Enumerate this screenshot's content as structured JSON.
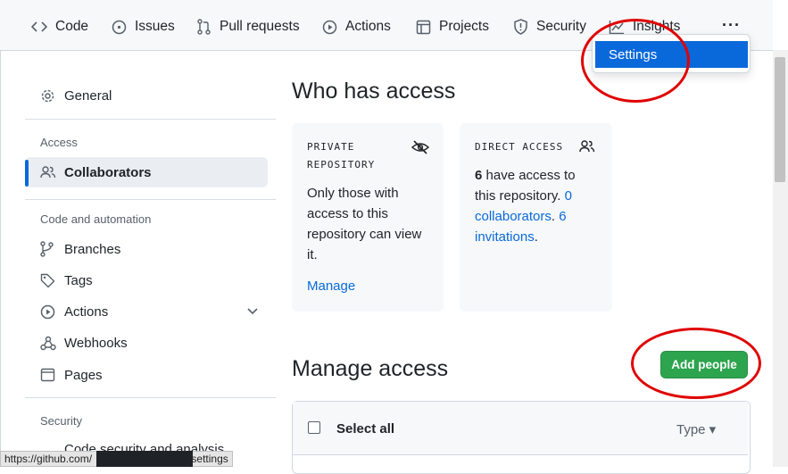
{
  "nav": {
    "items": [
      {
        "label": "Code",
        "icon": "code-icon"
      },
      {
        "label": "Issues",
        "icon": "issue-icon"
      },
      {
        "label": "Pull requests",
        "icon": "pull-request-icon"
      },
      {
        "label": "Actions",
        "icon": "play-icon"
      },
      {
        "label": "Projects",
        "icon": "table-icon"
      },
      {
        "label": "Security",
        "icon": "shield-icon"
      },
      {
        "label": "Insights",
        "icon": "graph-icon"
      }
    ],
    "more": "···"
  },
  "dropdown": {
    "settings_label": "Settings"
  },
  "sidebar": {
    "general": "General",
    "access_heading": "Access",
    "collaborators": "Collaborators",
    "code_heading": "Code and automation",
    "branches": "Branches",
    "tags": "Tags",
    "actions": "Actions",
    "webhooks": "Webhooks",
    "pages": "Pages",
    "security_heading": "Security",
    "code_security": "Code security and analysis"
  },
  "main": {
    "who_title": "Who has access",
    "private_card": {
      "label_line1": "PRIVATE",
      "label_line2": "REPOSITORY",
      "text_lines": [
        "Only those with",
        "access to this",
        "repository can view",
        "it."
      ],
      "manage_link": "Manage"
    },
    "direct_card": {
      "label": "DIRECT ACCESS",
      "count": "6",
      "line1_rest": " have access to",
      "line2_text": "this repository. ",
      "line2_link": "0",
      "line3_link": "collaborators",
      "line3_sep": ". ",
      "line3_link2": "6",
      "line4_link": "invitations",
      "line4_rest": "."
    },
    "manage_title": "Manage access",
    "add_people": "Add people",
    "select_all": "Select all",
    "type_filter": "Type ▾"
  },
  "statusbar": {
    "url_prefix": "https://github.com/",
    "url_suffix": "/settings"
  },
  "colors": {
    "accent": "#0969da",
    "primary_button": "#2da44e",
    "annotation": "#e00000"
  }
}
